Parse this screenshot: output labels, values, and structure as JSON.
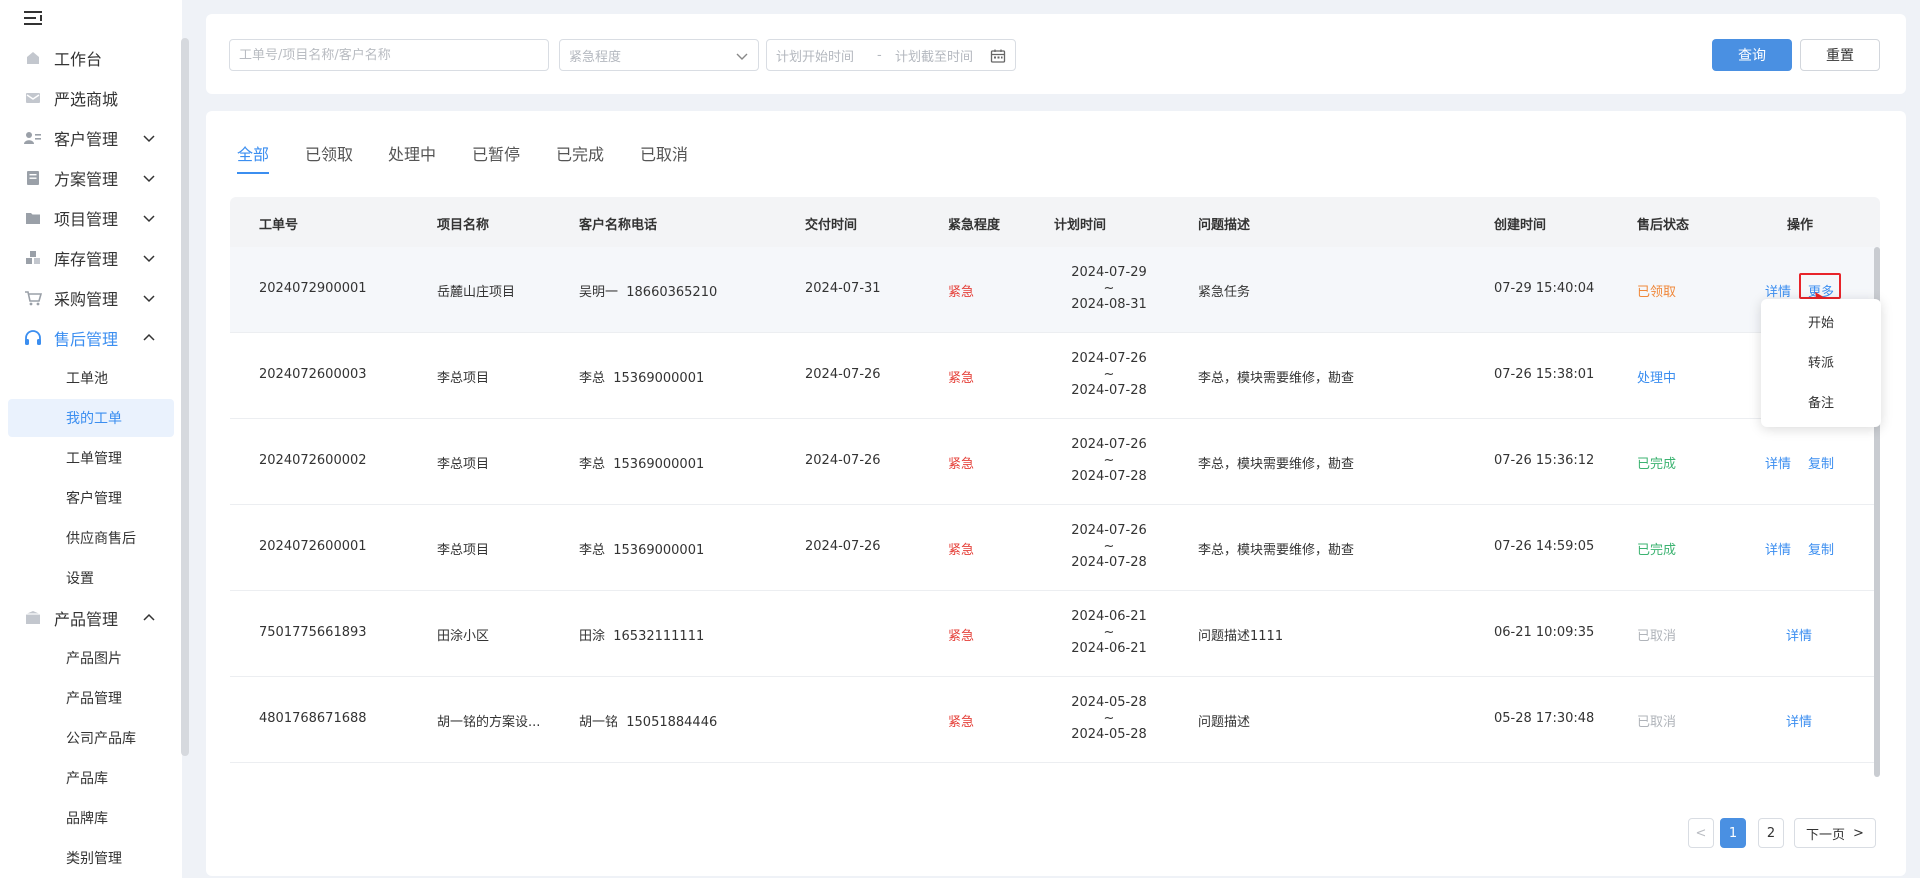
{
  "sidebar": {
    "items": [
      {
        "label": "工作台",
        "icon": "home-icon"
      },
      {
        "label": "严选商城",
        "icon": "mail-icon"
      },
      {
        "label": "客户管理",
        "icon": "user-card-icon"
      },
      {
        "label": "方案管理",
        "icon": "document-icon"
      },
      {
        "label": "项目管理",
        "icon": "folder-icon"
      },
      {
        "label": "库存管理",
        "icon": "inventory-icon"
      },
      {
        "label": "采购管理",
        "icon": "cart-icon"
      },
      {
        "label": "售后管理",
        "icon": "headset-icon"
      },
      {
        "label": "产品管理",
        "icon": "box-icon"
      }
    ],
    "after_sales_sub": [
      "工单池",
      "我的工单",
      "工单管理",
      "客户管理",
      "供应商售后",
      "设置"
    ],
    "product_sub": [
      "产品图片",
      "产品管理",
      "公司产品库",
      "产品库",
      "品牌库",
      "类别管理"
    ]
  },
  "filter": {
    "keyword_placeholder": "工单号/项目名称/客户名称",
    "urgency_placeholder": "紧急程度",
    "plan_start_placeholder": "计划开始时间",
    "date_sep": "-",
    "plan_end_placeholder": "计划截至时间",
    "query_label": "查询",
    "reset_label": "重置"
  },
  "tabs": [
    "全部",
    "已领取",
    "处理中",
    "已暂停",
    "已完成",
    "已取消"
  ],
  "table": {
    "headers": [
      "工单号",
      "项目名称",
      "客户名称电话",
      "交付时间",
      "紧急程度",
      "计划时间",
      "问题描述",
      "创建时间",
      "售后状态",
      "操作"
    ],
    "rows": [
      {
        "id": "2024072900001",
        "project": "岳麓山庄项目",
        "customer": "吴明一  18660365210",
        "delivery": "2024-07-31",
        "urgency": "紧急",
        "plan_start": "2024-07-29",
        "plan_tilde": "~",
        "plan_end": "2024-08-31",
        "desc": "紧急任务",
        "created": "07-29 15:40:04",
        "status": "已领取",
        "status_color": "#f0883a",
        "ops": [
          "详情",
          "更多"
        ]
      },
      {
        "id": "2024072600003",
        "project": "李总项目",
        "customer": "李总  15369000001",
        "delivery": "2024-07-26",
        "urgency": "紧急",
        "plan_start": "2024-07-26",
        "plan_tilde": "~",
        "plan_end": "2024-07-28",
        "desc": "李总，模块需要维修，勘查",
        "created": "07-26 15:38:01",
        "status": "处理中",
        "status_color": "#3b8ef0",
        "ops": []
      },
      {
        "id": "2024072600002",
        "project": "李总项目",
        "customer": "李总  15369000001",
        "delivery": "2024-07-26",
        "urgency": "紧急",
        "plan_start": "2024-07-26",
        "plan_tilde": "~",
        "plan_end": "2024-07-28",
        "desc": "李总，模块需要维修，勘查",
        "created": "07-26 15:36:12",
        "status": "已完成",
        "status_color": "#3cb371",
        "ops": [
          "详情",
          "复制"
        ]
      },
      {
        "id": "2024072600001",
        "project": "李总项目",
        "customer": "李总  15369000001",
        "delivery": "2024-07-26",
        "urgency": "紧急",
        "plan_start": "2024-07-26",
        "plan_tilde": "~",
        "plan_end": "2024-07-28",
        "desc": "李总，模块需要维修，勘查",
        "created": "07-26 14:59:05",
        "status": "已完成",
        "status_color": "#3cb371",
        "ops": [
          "详情",
          "复制"
        ]
      },
      {
        "id": "7501775661893",
        "project": "田涂小区",
        "customer": "田涂  16532111111",
        "delivery": "",
        "urgency": "紧急",
        "plan_start": "2024-06-21",
        "plan_tilde": "~",
        "plan_end": "2024-06-21",
        "desc": "问题描述1111",
        "created": "06-21 10:09:35",
        "status": "已取消",
        "status_color": "#b0b4ba",
        "ops": [
          "详情"
        ]
      },
      {
        "id": "4801768671688",
        "project": "胡一铭的方案设...",
        "customer": "胡一铭  15051884446",
        "delivery": "",
        "urgency": "紧急",
        "plan_start": "2024-05-28",
        "plan_tilde": "~",
        "plan_end": "2024-05-28",
        "desc": "问题描述",
        "created": "05-28 17:30:48",
        "status": "已取消",
        "status_color": "#b0b4ba",
        "ops": [
          "详情"
        ]
      }
    ]
  },
  "more_menu": [
    "开始",
    "转派",
    "备注"
  ],
  "pagination": {
    "prev": "<",
    "pages": [
      "1",
      "2"
    ],
    "next_label": "下一页",
    "next_arrow": ">"
  },
  "colors": {
    "accent": "#4a90e2",
    "urgent": "#e5413a",
    "highlight": "#e8242a"
  }
}
